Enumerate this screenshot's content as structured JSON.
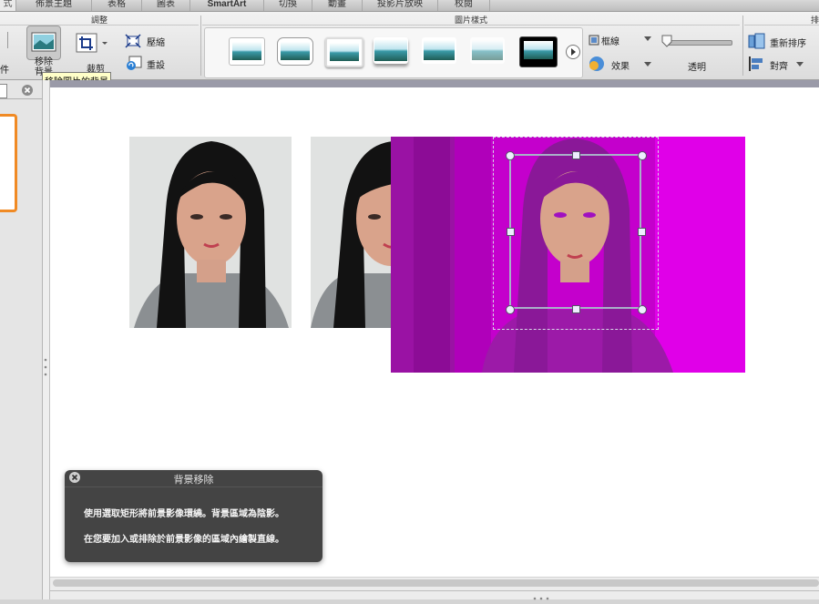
{
  "tabs": [
    "式",
    "佈景主題",
    "表格",
    "圖表",
    "SmartArt",
    "切換",
    "動畫",
    "投影片放映",
    "校閱"
  ],
  "ribbon": {
    "adjust_group": "調整",
    "left_cut_label": "件",
    "remove_bg_label": "移除背景",
    "crop_label": "裁剪",
    "compress_label": "壓縮",
    "reset_label": "重設",
    "styles_group": "圖片樣式",
    "border_label": "框線",
    "effects_label": "效果",
    "transparency_label": "透明",
    "rearrange_group": "排",
    "rearrange_label": "重新排序",
    "align_label": "對齊"
  },
  "tooltip": "移除圖片的背景",
  "hud": {
    "title": "背景移除",
    "line1": "使用選取矩形將前景影像環繞。背景區域為陰影。",
    "line2": "在您要加入或排除於前景影像的區域內繪製直線。"
  },
  "colors": {
    "magenta_overlay": "#d000d8",
    "slide_thumb_border": "#f08a24",
    "hud_bg": "#3a3a3a"
  },
  "icons": [
    "remove-background-icon",
    "crop-icon",
    "compress-icon",
    "reset-icon",
    "border-icon",
    "effects-icon",
    "more-styles-arrow-icon",
    "rearrange-icon",
    "align-icon",
    "close-icon"
  ]
}
